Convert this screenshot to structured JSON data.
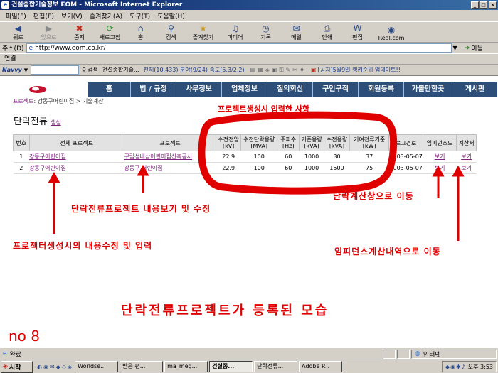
{
  "window": {
    "title": "건설종합기술정보 EOM - Microsoft Internet Explorer"
  },
  "menu": [
    "파일(F)",
    "편집(E)",
    "보기(V)",
    "즐겨찾기(A)",
    "도구(T)",
    "도움말(H)"
  ],
  "toolbar": {
    "back": "뒤로",
    "forward": "앞으로",
    "stop": "중지",
    "refresh": "새로고침",
    "home": "홈",
    "search": "검색",
    "favorites": "즐겨찾기",
    "media": "미디어",
    "history": "기록",
    "mail": "메일",
    "print": "인쇄",
    "edit": "편집",
    "real": "Real.com"
  },
  "address": {
    "label": "주소(D)",
    "url": "http://www.eom.co.kr/",
    "go": "이동",
    "links": "연결"
  },
  "navy": {
    "brand": "Navvy",
    "search": "검색",
    "site": "건설종합기술...",
    "counts": "전체(10,433) 분야(9/24) 속도(5,3/2,2)",
    "notice": "[공지]5월9일 랭키순위 업데이트!!"
  },
  "site": {
    "nav": [
      "홈",
      "법 / 규정",
      "사무정보",
      "업체정보",
      "질의회신",
      "구인구직",
      "회원등록",
      "가볼만한곳",
      "게시판"
    ],
    "breadcrumb": {
      "link": "프로젝트",
      "rest": ": 강동구어린이집 > 기술계산"
    },
    "title": "단락전류",
    "new_link": "생성"
  },
  "table": {
    "headers": [
      "번호",
      "전체 프로젝트",
      "프로젝트",
      "수전전압\n[kV]",
      "수전단락용량\n[MVA]",
      "주파수\n[Hz]",
      "기준용량\n[kVA]",
      "수전용량\n[kVA]",
      "기여전류기준\n[kW]",
      "로그경로",
      "임피던스도",
      "계산서"
    ],
    "rows": [
      [
        "1",
        "강동구어린이집",
        "구립성내삼어린이집신축공사",
        "22.9",
        "100",
        "60",
        "1000",
        "30",
        "37",
        "2003-05-07",
        "보기",
        "보기"
      ],
      [
        "2",
        "강동구어린이집",
        "강동구 어린이집",
        "22.9",
        "100",
        "60",
        "1000",
        "1500",
        "75",
        "2003-05-07",
        "보기",
        "보기"
      ]
    ]
  },
  "annotations": {
    "inputs": "프로젝트생성시 입력한 사항",
    "view_edit": "단락전류프로젝트 내용보기 및 수정",
    "create_edit": "프로젝터생성시의 내용수정 및 입력",
    "calc_window": "단락계산창으로 이동",
    "impedance": "임피던스계산내역으로 이동",
    "caption": "단락전류프로젝트가 등록된 모습",
    "number": "no 8"
  },
  "status": {
    "text": "완료",
    "zone": "인터넷"
  },
  "taskbar": {
    "start": "시작",
    "tasks": [
      "Worldse...",
      "받은 편...",
      "ma_meg...",
      "건설종...",
      "단락전류...",
      "Adobe P..."
    ],
    "clock": "오후 3:53"
  },
  "colors": {
    "title_bar": "#0a246a",
    "site_nav": "#2c4e79",
    "annotation": "#e00000",
    "link": "#802080"
  }
}
